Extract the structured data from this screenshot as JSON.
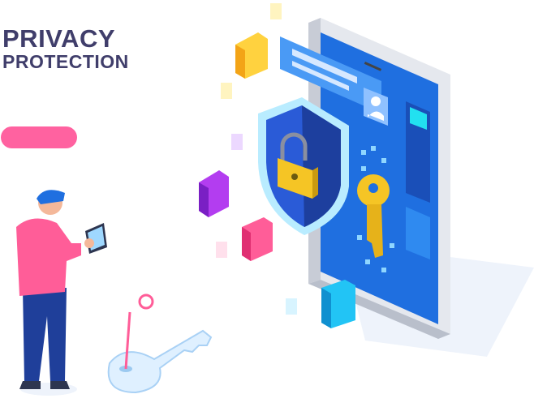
{
  "header": {
    "title_line1": "PRIVACY",
    "title_line2": "PROTECTION"
  },
  "colors": {
    "title": "#403e6b",
    "accent_pill": "#ff62a0",
    "phone_screen": "#1f6fe0",
    "shield": "#2a5bd7",
    "lock": "#f5c525",
    "key": "#f5c525"
  },
  "icons": [
    "phone",
    "shield-icon",
    "padlock-icon",
    "key-icon",
    "user-profile-icon",
    "person-with-tablet",
    "floor-key-icon"
  ]
}
